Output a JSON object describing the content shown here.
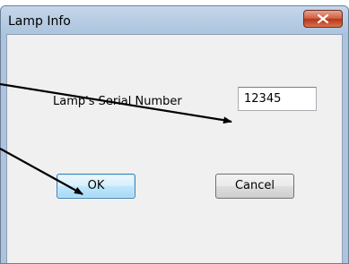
{
  "window": {
    "title": "Lamp Info",
    "close_icon": "close-x-icon"
  },
  "form": {
    "serial_label": "Lamp's Serial Number",
    "serial_value": "12345"
  },
  "buttons": {
    "ok_label": "OK",
    "cancel_label": "Cancel"
  },
  "colors": {
    "annotation_arrow": "#000000",
    "close_button": "#c84b2f",
    "default_button_border": "#3c7fb1"
  }
}
